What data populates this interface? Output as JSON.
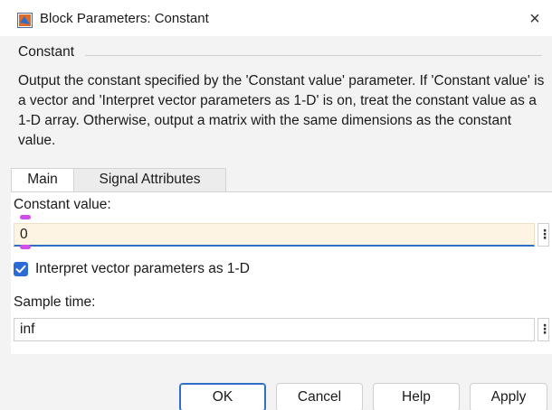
{
  "window": {
    "title": "Block Parameters: Constant",
    "close_glyph": "×"
  },
  "group": {
    "label": "Constant",
    "description": "Output the constant specified by the 'Constant value' parameter. If 'Constant value' is a vector and 'Interpret vector parameters as 1-D' is on, treat the constant value as a 1-D array. Otherwise, output a matrix with the same dimensions as the constant value."
  },
  "tabs": [
    {
      "label": "Main",
      "selected": true
    },
    {
      "label": "Signal Attributes",
      "selected": false
    }
  ],
  "fields": {
    "constant_value": {
      "label": "Constant value:",
      "value": "0"
    },
    "interpret_checkbox": {
      "label": "Interpret vector parameters as 1-D",
      "checked": true
    },
    "sample_time": {
      "label": "Sample time:",
      "value": "inf"
    }
  },
  "menu_glyph": "⋮",
  "buttons": {
    "ok": "OK",
    "cancel": "Cancel",
    "help": "Help",
    "apply": "Apply"
  },
  "colors": {
    "accent": "#2a6bd6",
    "active_field_bg": "#fdf4e3",
    "marker": "#d24ee8"
  },
  "icons": {
    "title": "simulink-block-icon",
    "close": "close-icon",
    "checkmark": "checkmark-icon",
    "menu": "vertical-ellipsis-icon"
  }
}
